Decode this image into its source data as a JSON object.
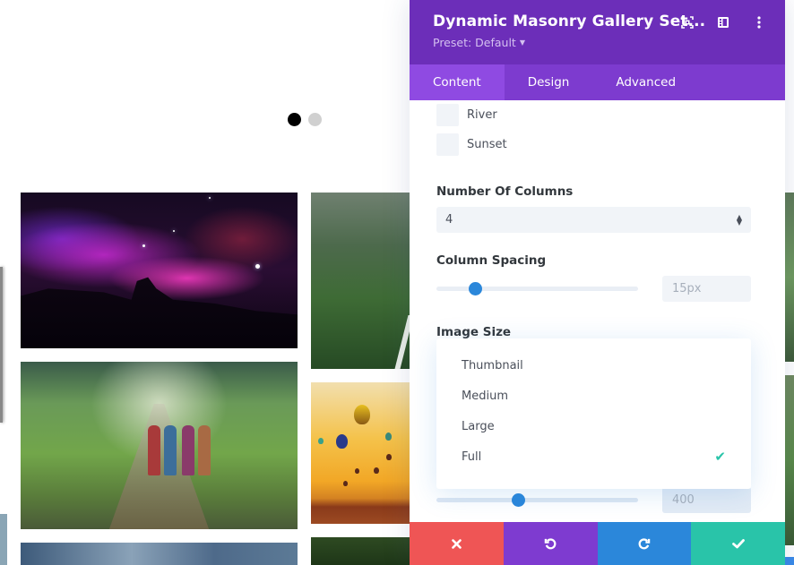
{
  "slider": {
    "dots": [
      {
        "active": true
      },
      {
        "active": false
      }
    ]
  },
  "gallery": {
    "images": [
      {
        "subject": "horsehead nebula"
      },
      {
        "subject": "misty forest"
      },
      {
        "subject": "women walking on rural path"
      },
      {
        "subject": "hot air balloons at sunset"
      },
      {
        "subject": "mountain landscape"
      },
      {
        "subject": "jungle foliage"
      }
    ]
  },
  "panel": {
    "title": "Dynamic Masonry Gallery Set...",
    "preset_label": "Preset: Default",
    "icons": {
      "focus": "focus-mode-icon",
      "layout": "sidebar-layout-icon",
      "more": "more-vertical-icon"
    },
    "tabs": [
      {
        "label": "Content",
        "active": true
      },
      {
        "label": "Design",
        "active": false
      },
      {
        "label": "Advanced",
        "active": false
      }
    ],
    "categories": [
      {
        "label": "River",
        "checked": false
      },
      {
        "label": "Sunset",
        "checked": false
      }
    ],
    "columns": {
      "label": "Number Of Columns",
      "value": "4"
    },
    "column_spacing": {
      "label": "Column Spacing",
      "value": "15px",
      "fraction": 0.17
    },
    "image_size": {
      "label": "Image Size",
      "options": [
        {
          "label": "Thumbnail",
          "selected": false
        },
        {
          "label": "Medium",
          "selected": false
        },
        {
          "label": "Large",
          "selected": false
        },
        {
          "label": "Full",
          "selected": true
        }
      ],
      "check_glyph": "✔"
    },
    "underlying_slider": {
      "value": "400",
      "fraction": 0.4
    },
    "footer": {
      "cancel": "close-icon",
      "undo": "undo-icon",
      "redo": "redo-icon",
      "save": "checkmark-icon"
    }
  }
}
